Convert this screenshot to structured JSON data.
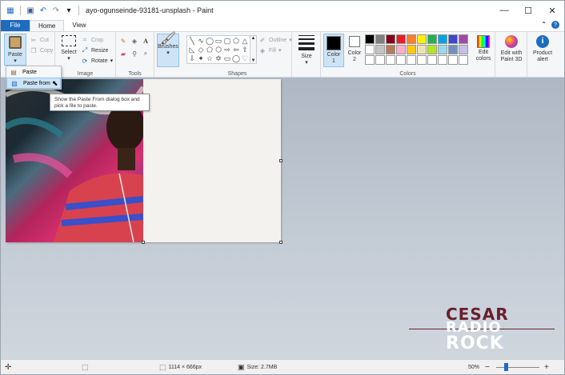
{
  "window": {
    "title": "ayo-ogunseinde-93181-unsplash - Paint",
    "controls": {
      "minimize": "—",
      "maximize": "☐",
      "close": "✕"
    }
  },
  "tabs": [
    {
      "label": "File"
    },
    {
      "label": "Home"
    },
    {
      "label": "View"
    }
  ],
  "ribbon": {
    "clipboard": {
      "paste": "Paste",
      "cut": "Cut",
      "copy": "Copy"
    },
    "image": {
      "select": "Select",
      "crop": "Crop",
      "resize": "Resize",
      "rotate": "Rotate",
      "label": "Image"
    },
    "tools": {
      "label": "Tools"
    },
    "brushes": {
      "label": "Brushes"
    },
    "shapes": {
      "outline": "Outline",
      "fill": "Fill",
      "label": "Shapes"
    },
    "size": {
      "label": "Size"
    },
    "colors": {
      "color1": "Color 1",
      "color2": "Color 2",
      "edit_colors": "Edit colors",
      "label": "Colors",
      "palette_row1": [
        "#000000",
        "#7f7f7f",
        "#880015",
        "#ed1c24",
        "#ff7f27",
        "#fff200",
        "#22b14c",
        "#00a2e8",
        "#3f48cc",
        "#a349a4"
      ],
      "palette_row2": [
        "#ffffff",
        "#c3c3c3",
        "#b97a57",
        "#ffaec9",
        "#ffc90e",
        "#efe4b0",
        "#b5e61d",
        "#99d9ea",
        "#7092be",
        "#c8bfe7"
      ],
      "palette_row3": [
        "#ffffff",
        "#ffffff",
        "#ffffff",
        "#ffffff",
        "#ffffff",
        "#ffffff",
        "#ffffff",
        "#ffffff",
        "#ffffff",
        "#ffffff"
      ]
    },
    "paint3d": "Edit with Paint 3D",
    "product_alert": "Product alert"
  },
  "paste_menu": {
    "items": [
      {
        "label": "Paste"
      },
      {
        "label": "Paste from"
      }
    ],
    "tooltip": "Show the Paste From dialog box and pick a file to paste."
  },
  "status": {
    "dimensions": "1114 × 666px",
    "size": "Size: 2.7MB",
    "zoom": "50%",
    "zoom_minus": "−",
    "zoom_plus": "+"
  },
  "watermark": {
    "line1": "CESAR",
    "line2": "RADIO",
    "line3": "ROCK"
  }
}
